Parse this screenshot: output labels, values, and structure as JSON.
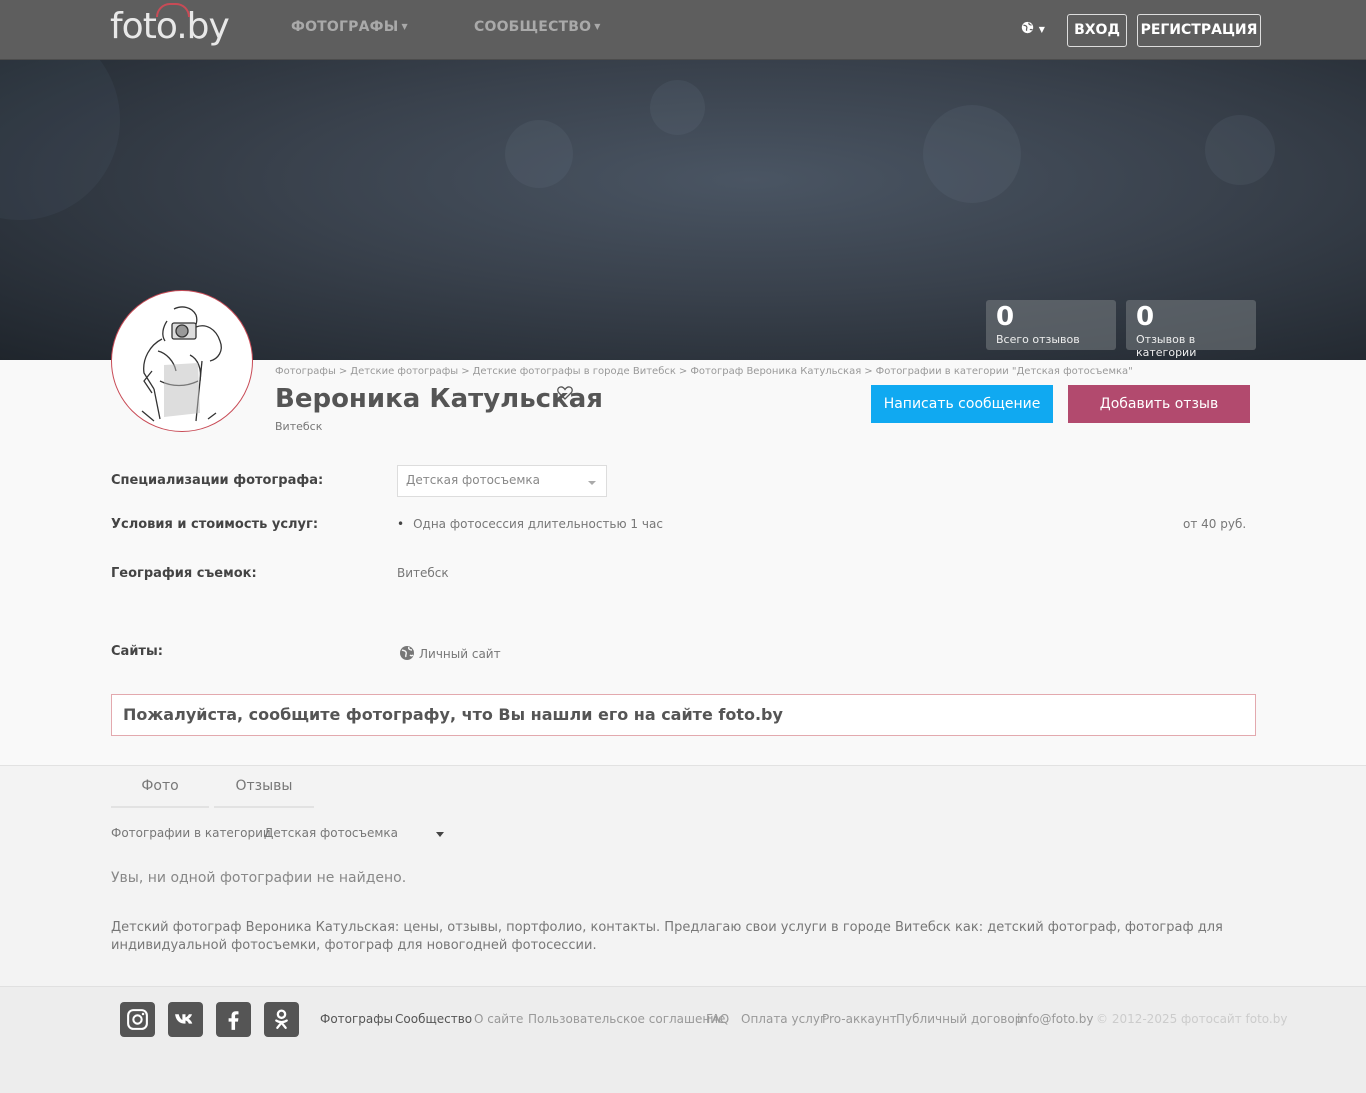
{
  "header": {
    "logo": "foto.by",
    "nav": [
      {
        "label": "ФОТОГРАФЫ"
      },
      {
        "label": "СООБЩЕСТВО"
      }
    ],
    "login_label": "ВХОД",
    "register_label": "РЕГИСТРАЦИЯ",
    "lang_icon": "globe-icon"
  },
  "stats": [
    {
      "value": "0",
      "label": "Всего отзывов"
    },
    {
      "value": "0",
      "label": "Отзывов в категории"
    }
  ],
  "breadcrumb": [
    "Фотографы",
    "Детские фотографы",
    "Детские фотографы в городе Витебск",
    "Фотограф Вероника Катульская",
    "Фотографии в категории \"Детская фотосъемка\""
  ],
  "profile": {
    "name": "Вероника Катульская",
    "city": "Витебск",
    "message_button": "Написать сообщение",
    "review_button": "Добавить отзыв"
  },
  "details": {
    "specializations_label": "Специализации фотографа:",
    "specialization_selected": "Детская фотосъемка",
    "services_label": "Условия и стоимость услуг:",
    "services": [
      {
        "name": "Одна фотосессия длительностью 1 час",
        "price": "от 40 руб."
      }
    ],
    "geography_label": "География съемок:",
    "geography_value": "Витебск",
    "sites_label": "Сайты:",
    "site_link": "Личный сайт"
  },
  "notice": "Пожалуйста, сообщите фотографу, что Вы нашли его на сайте foto.by",
  "tabs": [
    {
      "label": "Фото"
    },
    {
      "label": "Отзывы"
    }
  ],
  "photos": {
    "category_label": "Фотографии в категории",
    "category_value": "Детская фотосъемка",
    "empty_message": "Увы, ни одной фотографии не найдено."
  },
  "description": "Детский фотограф Вероника Катульская: цены, отзывы, портфолио, контакты. Предлагаю свои услуги в городе Витебск как: детский фотограф, фотограф для индивидуальной фотосъемки, фотограф для новогодней фотосессии.",
  "footer": {
    "social": [
      "instagram-icon",
      "vk-icon",
      "facebook-icon",
      "odnoklassniki-icon"
    ],
    "links": [
      "Фотографы",
      "Сообщество",
      "О сайте",
      "Пользовательское соглашение",
      "FAQ",
      "Оплата услуг",
      "Pro-аккаунт",
      "Публичный договор",
      "info@foto.by"
    ],
    "copyright": "© 2012-2025 фотосайт foto.by"
  },
  "colors": {
    "header_bg": "#5e5e5e",
    "accent_blue": "#10a9f1",
    "accent_pink": "#b24a6e",
    "brand_red": "#c84b56"
  }
}
